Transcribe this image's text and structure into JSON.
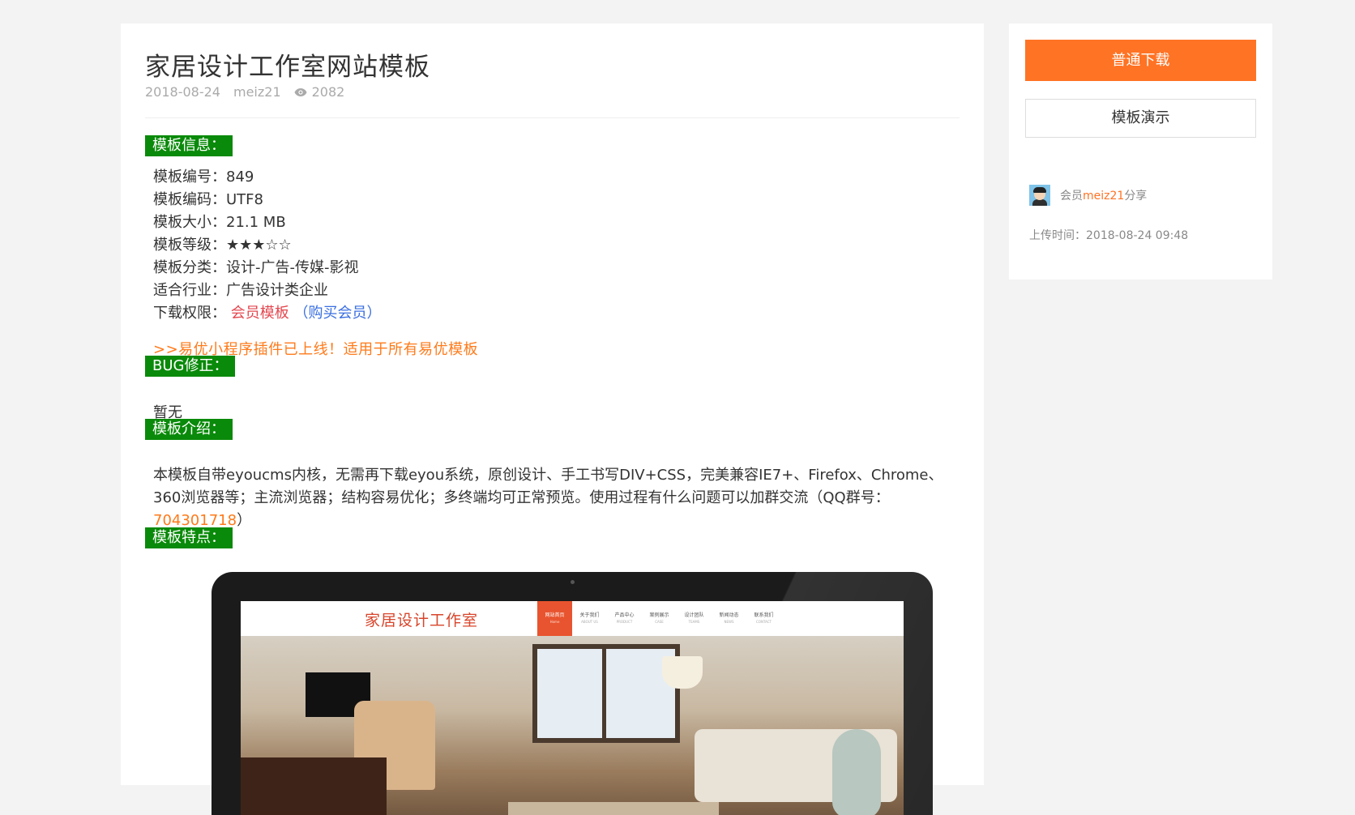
{
  "article": {
    "title": "家居设计工作室网站模板",
    "date": "2018-08-24",
    "author": "meiz21",
    "views": "2082"
  },
  "sections": {
    "info_label": "模板信息：",
    "bug_label": "BUG修正：",
    "intro_label": "模板介绍：",
    "features_label": "模板特点："
  },
  "info": {
    "number": "模板编号：849",
    "encoding": "模板编码：UTF8",
    "size": "模板大小：21.1 MB",
    "level_label": "模板等级：",
    "level_stars": "★★★☆☆",
    "category": "模板分类：设计-广告-传媒-影视",
    "industry": "适合行业：广告设计类企业",
    "permission_label": "下载权限：",
    "permission_value": "会员模板",
    "buy_open": "（",
    "buy_link": "购买会员",
    "buy_close": "）"
  },
  "notice": ">>易优小程序插件已上线！适用于所有易优模板",
  "bug_text": "暂无",
  "intro": {
    "text": "本模板自带eyoucms内核，无需再下载eyou系统，原创设计、手工书写DIV+CSS，完美兼容IE7+、Firefox、Chrome、360浏览器等；主流浏览器；结构容易优化；多终端均可正常预览。使用过程有什么问题可以加群交流（QQ群号：",
    "qq": "704301718",
    "close": "）"
  },
  "preview": {
    "site_logo": "家居设计工作室",
    "nav": [
      {
        "cn": "网站首页",
        "en": "Home"
      },
      {
        "cn": "关于我们",
        "en": "ABOUT US"
      },
      {
        "cn": "产品中心",
        "en": "PRODUCT"
      },
      {
        "cn": "案例展示",
        "en": "CASE"
      },
      {
        "cn": "设计团队",
        "en": "TEAMS"
      },
      {
        "cn": "新闻动态",
        "en": "NEWS"
      },
      {
        "cn": "联系我们",
        "en": "CONTACT"
      }
    ]
  },
  "sidebar": {
    "download_label": "普通下载",
    "demo_label": "模板演示",
    "member_prefix": "会员",
    "member_name": "meiz21",
    "member_suffix": "分享",
    "upload_time": "上传时间：2018-08-24 09:48"
  },
  "colors": {
    "accent": "#ff7324",
    "section_label_bg": "#0a8a0a",
    "background": "#f3f3f3"
  }
}
